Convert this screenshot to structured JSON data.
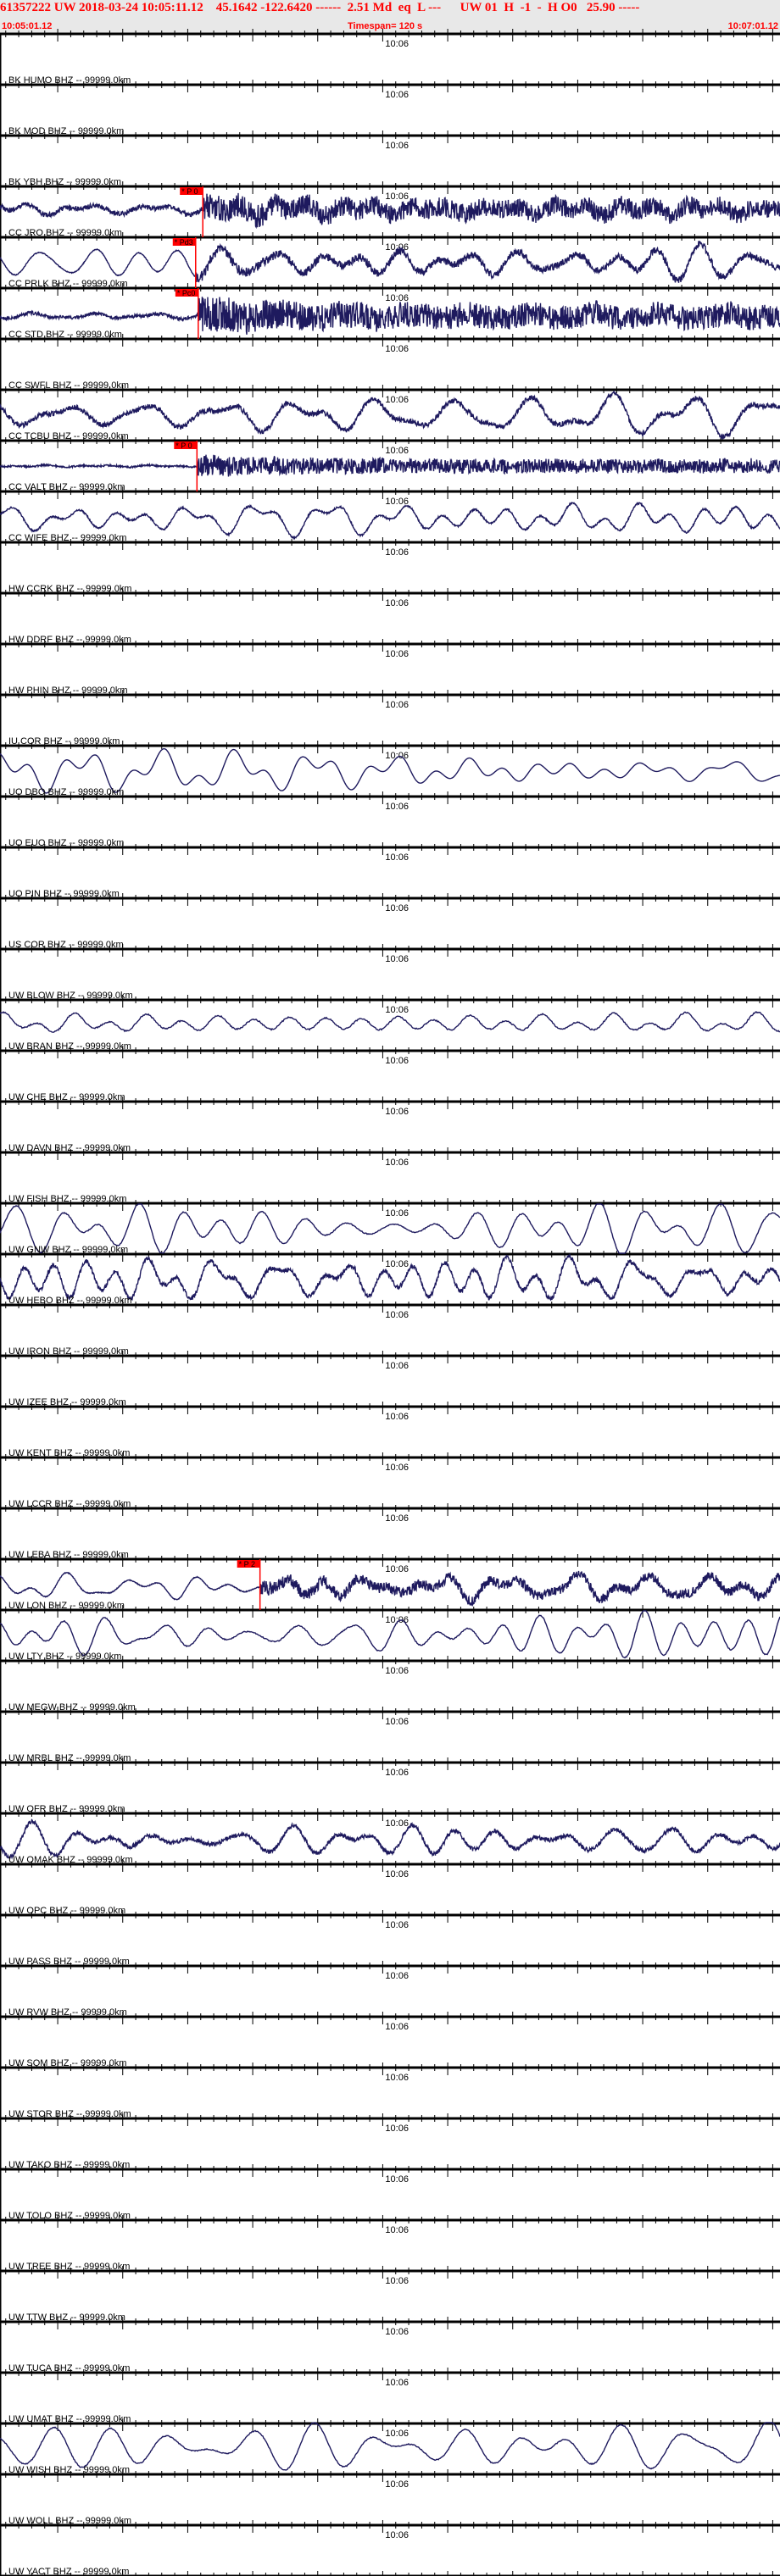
{
  "header": {
    "event_line": "61357222 UW 2018-03-24 10:05:11.12    45.1642 -122.6420 ------  2.51 Md  eq  L ---      UW 01  H  -1  -  H O0   25.90 -----",
    "start_time": "10:05:01.12",
    "timespan": "Timespan= 120 s",
    "end_time": "10:07:01.12"
  },
  "axis": {
    "minute_label": "10:06",
    "start_seconds": 1.12,
    "span_seconds": 120
  },
  "colors": {
    "trace": "#1e1a5e",
    "pick": "#ff0000",
    "header_text": "#ff0000",
    "header_bg": "#e8e8e8"
  },
  "channels": [
    {
      "label": "BK HUMO BHZ -- 99999.0km",
      "trace": false
    },
    {
      "label": "BK MOD BHZ -- 99999.0km",
      "trace": false
    },
    {
      "label": "BK YBH BHZ -- 99999.0km",
      "trace": true,
      "pick": {
        "text": "* P 0",
        "time_s": 31.2
      }
    },
    {
      "label": "CC JRO BHZ -- 99999.0km",
      "trace": true,
      "pick": {
        "text": "* Pd3",
        "time_s": 30.1
      }
    },
    {
      "label": "CC PRLK BHZ -- 99999.0km",
      "trace": true,
      "pick": {
        "text": "* Pc0",
        "time_s": 30.5
      }
    },
    {
      "label": "CC STD BHZ -- 99999.0km",
      "trace": false
    },
    {
      "label": "CC SWFL BHZ -- 99999.0km",
      "trace": true
    },
    {
      "label": "CC TCBU BHZ -- 99999.0km",
      "trace": true,
      "pick": {
        "text": "* P 0",
        "time_s": 30.3
      }
    },
    {
      "label": "CC VALT BHZ -- 99999.0km",
      "trace": true
    },
    {
      "label": "CC WIFE BHZ -- 99999.0km",
      "trace": false
    },
    {
      "label": "HW CCRK BHZ -- 99999.0km",
      "trace": false
    },
    {
      "label": "HW DDRF BHZ -- 99999.0km",
      "trace": false
    },
    {
      "label": "HW PHIN BHZ -- 99999.0km",
      "trace": false
    },
    {
      "label": "IU COR BHZ -- 99999.0km",
      "trace": true
    },
    {
      "label": "UO DBO BHZ -- 99999.0km",
      "trace": false
    },
    {
      "label": "UO EUO BHZ -- 99999.0km",
      "trace": false
    },
    {
      "label": "UO PIN BHZ -- 99999.0km",
      "trace": false
    },
    {
      "label": "US COR BHZ -- 99999.0km",
      "trace": false
    },
    {
      "label": "UW BLOW BHZ -- 99999.0km",
      "trace": true
    },
    {
      "label": "UW BRAN BHZ -- 99999.0km",
      "trace": false
    },
    {
      "label": "UW CHE BHZ -- 99999.0km",
      "trace": false
    },
    {
      "label": "UW DAVN BHZ -- 99999.0km",
      "trace": false
    },
    {
      "label": "UW FISH BHZ -- 99999.0km",
      "trace": true
    },
    {
      "label": "UW GNW BHZ -- 99999.0km",
      "trace": true
    },
    {
      "label": "UW HEBO BHZ -- 99999.0km",
      "trace": false
    },
    {
      "label": "UW IRON BHZ -- 99999.0km",
      "trace": false
    },
    {
      "label": "UW IZEE BHZ -- 99999.0km",
      "trace": false
    },
    {
      "label": "UW KENT BHZ -- 99999.0km",
      "trace": false
    },
    {
      "label": "UW LCCR BHZ -- 99999.0km",
      "trace": false
    },
    {
      "label": "UW LEBA BHZ -- 99999.0km",
      "trace": true,
      "pick": {
        "text": "* P 2",
        "time_s": 40.0
      }
    },
    {
      "label": "UW LON BHZ -- 99999.0km",
      "trace": true
    },
    {
      "label": "UW LTY BHZ -- 99999.0km",
      "trace": false
    },
    {
      "label": "UW MEGW BHZ -- 99999.0km",
      "trace": false
    },
    {
      "label": "UW MRBL BHZ -- 99999.0km",
      "trace": false
    },
    {
      "label": "UW OFR BHZ -- 99999.0km",
      "trace": true
    },
    {
      "label": "UW OMAK BHZ -- 99999.0km",
      "trace": false
    },
    {
      "label": "UW OPC BHZ -- 99999.0km",
      "trace": false
    },
    {
      "label": "UW PASS BHZ -- 99999.0km",
      "trace": false
    },
    {
      "label": "UW RVW BHZ -- 99999.0km",
      "trace": false
    },
    {
      "label": "UW SQM BHZ -- 99999.0km",
      "trace": false
    },
    {
      "label": "UW STOR BHZ -- 99999.0km",
      "trace": false
    },
    {
      "label": "UW TAKO BHZ -- 99999.0km",
      "trace": false
    },
    {
      "label": "UW TOLO BHZ -- 99999.0km",
      "trace": false
    },
    {
      "label": "UW TREE BHZ -- 99999.0km",
      "trace": false
    },
    {
      "label": "UW TTW BHZ -- 99999.0km",
      "trace": false
    },
    {
      "label": "UW TUCA BHZ -- 99999.0km",
      "trace": false
    },
    {
      "label": "UW UMAT BHZ -- 99999.0km",
      "trace": true
    },
    {
      "label": "UW WISH BHZ -- 99999.0km",
      "trace": false
    },
    {
      "label": "UW WOLL BHZ -- 99999.0km",
      "trace": false
    },
    {
      "label": "UW YACT BHZ -- 99999.0km",
      "trace": false
    }
  ]
}
